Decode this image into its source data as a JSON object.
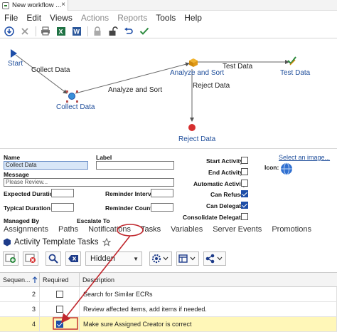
{
  "window": {
    "tab_title": "New workflow ...",
    "close_glyph": "×"
  },
  "menu": {
    "items": [
      {
        "label": "File",
        "enabled": true
      },
      {
        "label": "Edit",
        "enabled": true
      },
      {
        "label": "Views",
        "enabled": true
      },
      {
        "label": "Actions",
        "enabled": false
      },
      {
        "label": "Reports",
        "enabled": false
      },
      {
        "label": "Tools",
        "enabled": true
      },
      {
        "label": "Help",
        "enabled": true
      }
    ]
  },
  "toolbar": {
    "icons": [
      "save-icon",
      "delete-icon",
      "print-icon",
      "excel-icon",
      "word-icon",
      "lock-icon",
      "unlock-icon",
      "undo-icon",
      "check-icon"
    ]
  },
  "workflow": {
    "nodes": {
      "start": "Start",
      "collect": "Collect Data",
      "analyze": "Analyze and Sort",
      "test": "Test Data",
      "reject": "Reject Data"
    },
    "edges": {
      "collect": "Collect Data",
      "analyze": "Analyze and Sort",
      "test": "Test Data",
      "reject": "Reject Data"
    }
  },
  "properties": {
    "name_label": "Name",
    "name_value": "Collect Data",
    "label_label": "Label",
    "label_value": "",
    "message_label": "Message",
    "message_placeholder": "Please Review...",
    "expected_duration_label": "Expected Duration",
    "expected_duration_value": "",
    "reminder_interval_label": "Reminder Interval",
    "reminder_interval_value": "",
    "typical_duration_label": "Typical Duration",
    "typical_duration_value": "",
    "reminder_count_label": "Reminder Count",
    "reminder_count_value": "",
    "managed_by_label": "Managed By",
    "escalate_to_label": "Escalate To",
    "flags": [
      {
        "label": "Start Activity",
        "checked": false
      },
      {
        "label": "End Activity",
        "checked": false
      },
      {
        "label": "Automatic Activity",
        "checked": false
      },
      {
        "label": "Can Refuse",
        "checked": true
      },
      {
        "label": "Can Delegate",
        "checked": true
      },
      {
        "label": "Consolidate Delegated",
        "checked": false
      }
    ],
    "select_image_link": "Select an image...",
    "icon_label": "Icon:"
  },
  "tabs": [
    "Assignments",
    "Paths",
    "Notifications",
    "Tasks",
    "Variables",
    "Server Events",
    "Promotions"
  ],
  "active_tab": "Tasks",
  "tasks_section": {
    "title": "Activity Template Tasks",
    "dropdown_value": "Hidden"
  },
  "table": {
    "headers": [
      "Sequen...",
      "Required",
      "Description"
    ],
    "rows": [
      {
        "seq": "2",
        "required": false,
        "description": "Search for Similar ECRs",
        "highlight": false
      },
      {
        "seq": "3",
        "required": false,
        "description": "Review affected items, add items if needed.",
        "highlight": false
      },
      {
        "seq": "4",
        "required": true,
        "description": "Make sure Assigned Creator is correct",
        "highlight": true
      }
    ]
  },
  "colors": {
    "link": "#1f4e9b",
    "annotation": "#c0272d",
    "highlight_row": "#fff7b8",
    "checkbox": "#1e4ea8"
  }
}
